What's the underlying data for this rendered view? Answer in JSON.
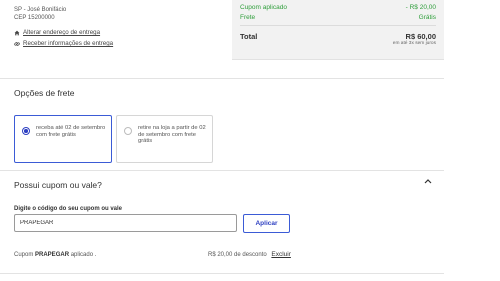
{
  "address": {
    "city_line": "SP - José Bonifácio",
    "zip_line": "CEP 15200000",
    "change_address_link": "Alterar endereço de entrega",
    "receive_info_link": "Receber informações de entrega"
  },
  "summary": {
    "coupon_label": "Cupom aplicado",
    "coupon_value": "- R$ 20,00",
    "shipping_label": "Frete",
    "shipping_value": "Grátis",
    "total_label": "Total",
    "total_value": "R$ 60,00",
    "installments": "em até 3x sem juros",
    "accent_green": "#2e9e3a"
  },
  "shipping": {
    "title": "Opções de frete",
    "options": [
      {
        "label": "receba até 02 de setembro com frete grátis",
        "selected": true
      },
      {
        "label": "retire na loja a partir de 02 de setembro com frete grátis",
        "selected": false
      }
    ],
    "accent_blue": "#2d3fc1"
  },
  "coupon": {
    "title": "Possui cupom ou vale?",
    "collapse_icon": "chevron-up-icon",
    "input_label": "Digite o código do seu cupom ou vale",
    "input_value": "PRAPEGAR",
    "apply_button": "Aplicar",
    "applied_prefix": "Cupom",
    "applied_code": "PRAPEGAR",
    "applied_suffix": "aplicado .",
    "discount_text": "R$ 20,00 de desconto",
    "remove_link": "Excluir"
  }
}
